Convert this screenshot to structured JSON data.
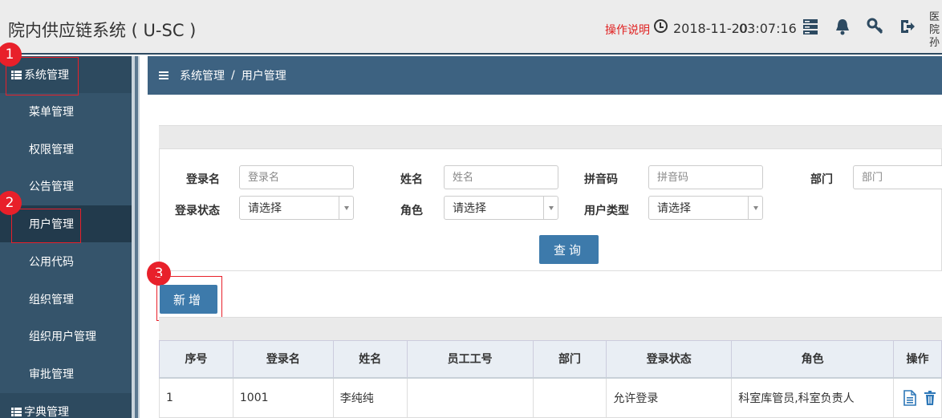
{
  "header": {
    "title": "院内供应链系统 ( U-SC )",
    "help_label": "操作说明",
    "date": "2018-11-20",
    "time": "03:07:16",
    "user_snippet": "医院 孙"
  },
  "sidebar": {
    "groups": [
      {
        "label": "系统管理",
        "items": [
          "菜单管理",
          "权限管理",
          "公告管理",
          "用户管理",
          "公用代码",
          "组织管理",
          "组织用户管理",
          "审批管理"
        ]
      },
      {
        "label": "字典管理"
      }
    ],
    "active_item": "用户管理"
  },
  "breadcrumb": {
    "root": "系统管理",
    "sep": "/",
    "current": "用户管理"
  },
  "search": {
    "login_name_label": "登录名",
    "login_name_placeholder": "登录名",
    "name_label": "姓名",
    "name_placeholder": "姓名",
    "pinyin_label": "拼音码",
    "pinyin_placeholder": "拼音码",
    "dept_label": "部门",
    "dept_placeholder": "部门",
    "login_status_label": "登录状态",
    "login_status_value": "请选择",
    "role_label": "角色",
    "role_value": "请选择",
    "user_type_label": "用户类型",
    "user_type_value": "请选择",
    "query_button": "查询"
  },
  "add_button": "新增",
  "markers": [
    "1",
    "2",
    "3"
  ],
  "table": {
    "headers": [
      "序号",
      "登录名",
      "姓名",
      "员工工号",
      "部门",
      "登录状态",
      "角色",
      "操作"
    ],
    "rows": [
      [
        "1",
        "1001",
        "李纯纯",
        "",
        "",
        "允许登录",
        "科室库管员,科室负责人",
        ""
      ]
    ]
  },
  "colors": {
    "header_bg": "#ececec",
    "sidebar_bg": "#35546b",
    "accent": "#3d7aab",
    "marker": "#e8202a"
  }
}
